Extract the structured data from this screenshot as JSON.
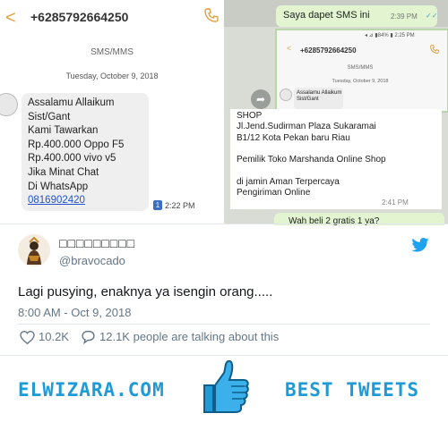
{
  "sms": {
    "back_glyph": "<",
    "number": "+6285792664250",
    "message_kind": "SMS/MMS",
    "date": "Tuesday, October 9, 2018",
    "message_lines": "Assalamu Allaikum\nSist/Gant\nKami Tawarkan\nRp.400.000 Oppo F5\nRp.400.000 vivo v5\nJika Minat Chat\nDi WhatsApp",
    "message_link": "0816902420",
    "sim_badge": "1",
    "time": "2:22 PM",
    "accent_color": "#e0a040",
    "link_color": "#2255cc"
  },
  "whatsapp": {
    "outgoing_1": "Saya dapet SMS ini",
    "outgoing_1_time": "2:39 PM",
    "outgoing_1_ticks": "✓✓",
    "inner_status": "◂ ⊿ ▮84% ▮ 2:25 PM",
    "inner_back": "<",
    "inner_number": "+6285792664250",
    "inner_kind": "SMS/MMS",
    "inner_date": "Tuesday, October 9, 2018",
    "inner_message": "Assalamu Allaikum\nSist/Gant",
    "forward_glyph": "➦",
    "incoming_text": "SHOP\nJl.Jend.Sudirman Plaza Sukaramai\nB1/12 Kota Pekan baru Riau\n\nPemilik Toko Marshanda Online Shop\n\ndi jamin Aman Terpercaya\nPengiriman Online",
    "incoming_time": "2:41 PM",
    "outgoing_2": "Wah beli 2 gratis 1 ya?",
    "bubble_color": "#e2f5d0"
  },
  "tweet": {
    "display_name": "□□□□□□□□□",
    "handle": "@bravocado",
    "text": "Lagi pusying, enaknya ya isengin orang.....",
    "timestamp": "8:00 AM - Oct 9, 2018",
    "likes": "10.2K",
    "talking": "12.1K people are talking about this",
    "brand_color": "#1da1f2"
  },
  "footer": {
    "site": "ELWIZARA.COM",
    "tagline": "BEST TWEETS",
    "color": "#1f9ad6"
  }
}
